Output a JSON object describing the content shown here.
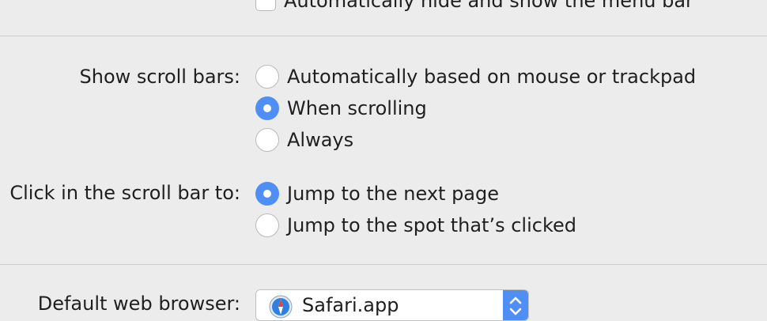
{
  "menu_bar_option": {
    "label": "Automatically hide and show the menu bar",
    "checked": false
  },
  "scroll_bars": {
    "label": "Show scroll bars:",
    "options": [
      {
        "label": "Automatically based on mouse or trackpad",
        "selected": false
      },
      {
        "label": "When scrolling",
        "selected": true
      },
      {
        "label": "Always",
        "selected": false
      }
    ]
  },
  "scroll_click": {
    "label": "Click in the scroll bar to:",
    "options": [
      {
        "label": "Jump to the next page",
        "selected": true
      },
      {
        "label": "Jump to the spot that’s clicked",
        "selected": false
      }
    ]
  },
  "default_browser": {
    "label": "Default web browser:",
    "value": "Safari.app",
    "icon": "safari-compass-icon"
  },
  "colors": {
    "accent": "#4f8ff5",
    "background": "#ececec"
  }
}
